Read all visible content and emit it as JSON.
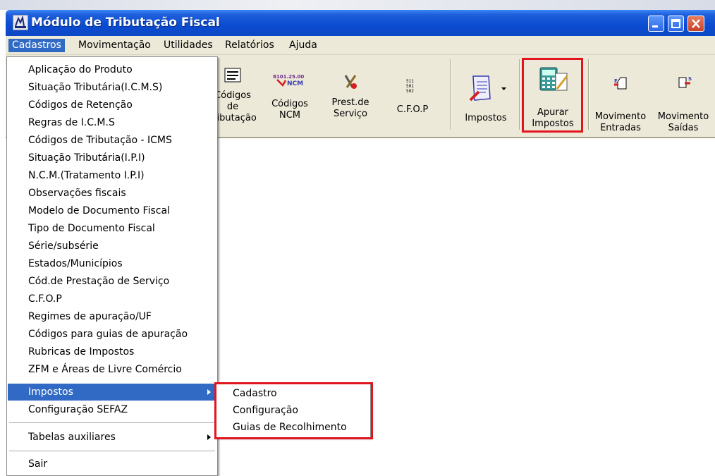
{
  "window": {
    "title": "Módulo de Tributação Fiscal"
  },
  "menubar": [
    {
      "id": "cadastros",
      "label": "Cadastros"
    },
    {
      "id": "mov",
      "label": "Movimentação"
    },
    {
      "id": "util",
      "label": "Utilidades"
    },
    {
      "id": "rel",
      "label": "Relatórios"
    },
    {
      "id": "ajuda",
      "label": "Ajuda"
    }
  ],
  "toolbar": {
    "codigos_tributacao": [
      "Códigos",
      "de",
      "Tributação"
    ],
    "codigos_ncm": [
      "Códigos",
      "NCM"
    ],
    "ncm_icon_text": "8101.25.00",
    "prest_servico": [
      "Prest.de",
      "Serviço"
    ],
    "cfop": "C.F.O.P",
    "impostos": "Impostos",
    "apurar": [
      "Apurar",
      "Impostos"
    ],
    "mov_entradas": [
      "Movimento",
      "Entradas"
    ],
    "mov_saidas": [
      "Movimento",
      "Saídas"
    ]
  },
  "dropdown": {
    "items": [
      "Aplicação do Produto",
      "Situação Tributária(I.C.M.S)",
      "Códigos de Retenção",
      "Regras de I.C.M.S",
      "Códigos de Tributação - ICMS",
      "Situação Tributária(I.P.I)",
      "N.C.M.(Tratamento I.P.I)",
      "Observações fiscais",
      "Modelo de Documento Fiscal",
      "Tipo de Documento Fiscal",
      "Série/subsérie",
      "Estados/Municípios",
      "Cód.de Prestação de Serviço",
      "C.F.O.P",
      "Regimes de apuração/UF",
      "Códigos para guias de apuração",
      "Rubricas de Impostos",
      "ZFM e Áreas de Livre Comércio",
      "Impostos",
      "Configuração SEFAZ"
    ],
    "tabelas": "Tabelas auxiliares",
    "sair": "Sair"
  },
  "submenu": [
    "Cadastro",
    "Configuração",
    "Guias de Recolhimento"
  ],
  "colors": {
    "highlight": "#316ac5",
    "annotation": "#e2141e",
    "titlebar": "#0a4bd0"
  }
}
